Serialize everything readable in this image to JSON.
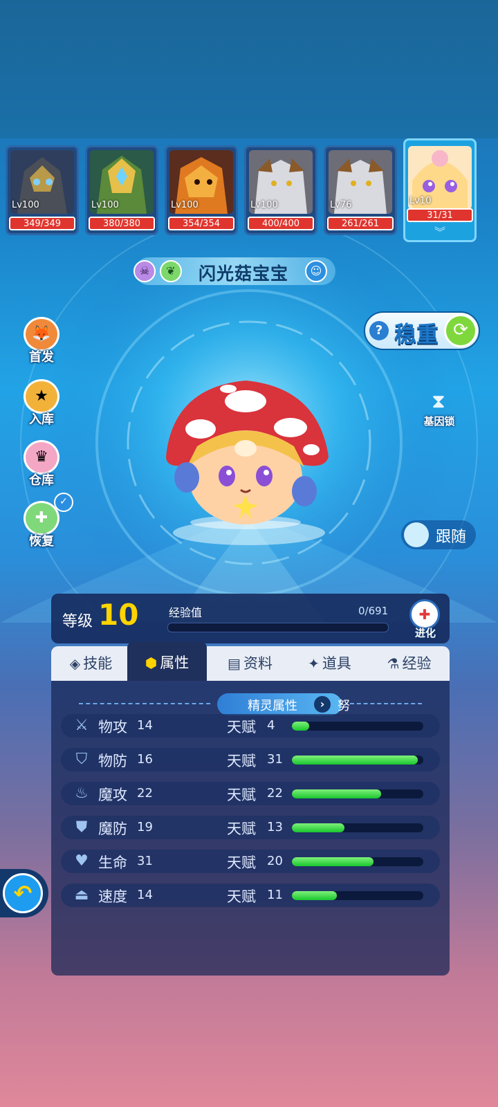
{
  "team": [
    {
      "level": "Lv100",
      "hp": "349/349",
      "colors": [
        "#4a4f58",
        "#b99a4a"
      ]
    },
    {
      "level": "Lv100",
      "hp": "380/380",
      "colors": [
        "#5a8a3a",
        "#e6c04a"
      ]
    },
    {
      "level": "Lv100",
      "hp": "354/354",
      "colors": [
        "#e07a20",
        "#f3b040"
      ]
    },
    {
      "level": "Lv100",
      "hp": "400/400",
      "colors": [
        "#d9d9e0",
        "#8a5a2a"
      ]
    },
    {
      "level": "Lv76",
      "hp": "261/261",
      "colors": [
        "#d9d9e0",
        "#8a5a2a"
      ]
    },
    {
      "level": "Lv10",
      "hp": "31/31",
      "colors": [
        "#ffd98a",
        "#f7b7c9"
      ],
      "selected": true
    }
  ],
  "pet": {
    "name": "闪光菇宝宝"
  },
  "side_buttons": [
    {
      "label": "首发"
    },
    {
      "label": "入库"
    },
    {
      "label": "仓库"
    },
    {
      "label": "恢复"
    }
  ],
  "stability": {
    "label": "稳重"
  },
  "gene_lock": {
    "label": "基因锁"
  },
  "follow": {
    "label": "跟随"
  },
  "level_panel": {
    "level_label": "等级",
    "level": "10",
    "exp_label": "经验值",
    "exp": "0/691",
    "evolve_label": "进化"
  },
  "tabs": [
    {
      "label": "技能",
      "icon": "diamond-icon"
    },
    {
      "label": "属性",
      "icon": "hexagon-icon",
      "active": true
    },
    {
      "label": "资料",
      "icon": "clipboard-icon"
    },
    {
      "label": "道具",
      "icon": "pin-icon"
    },
    {
      "label": "经验",
      "icon": "flask-icon"
    }
  ],
  "attributes": {
    "section_label": "精灵属性",
    "nature": "努",
    "talent_label": "天赋",
    "rows": [
      {
        "name": "物攻",
        "value": "14",
        "talent": "4",
        "fill": 0.13,
        "icon": "sword-icon"
      },
      {
        "name": "物防",
        "value": "16",
        "talent": "31",
        "fill": 0.96,
        "icon": "shield-icon"
      },
      {
        "name": "魔攻",
        "value": "22",
        "talent": "22",
        "fill": 0.68,
        "icon": "flame-icon"
      },
      {
        "name": "魔防",
        "value": "19",
        "talent": "13",
        "fill": 0.4,
        "icon": "magic-shield-icon"
      },
      {
        "name": "生命",
        "value": "31",
        "talent": "20",
        "fill": 0.62,
        "icon": "heart-icon"
      },
      {
        "name": "速度",
        "value": "14",
        "talent": "11",
        "fill": 0.34,
        "icon": "boot-icon"
      }
    ]
  }
}
